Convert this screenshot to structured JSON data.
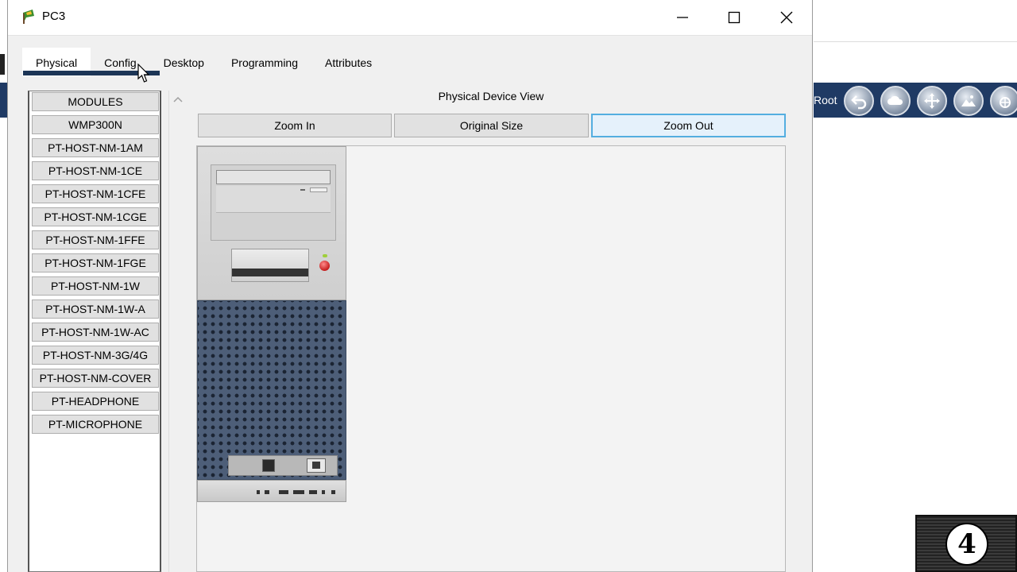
{
  "window": {
    "title": "PC3"
  },
  "tabs": [
    {
      "label": "Physical",
      "active": true
    },
    {
      "label": "Config",
      "active": false
    },
    {
      "label": "Desktop",
      "active": false
    },
    {
      "label": "Programming",
      "active": false
    },
    {
      "label": "Attributes",
      "active": false
    }
  ],
  "modules": [
    "MODULES",
    "WMP300N",
    "PT-HOST-NM-1AM",
    "PT-HOST-NM-1CE",
    "PT-HOST-NM-1CFE",
    "PT-HOST-NM-1CGE",
    "PT-HOST-NM-1FFE",
    "PT-HOST-NM-1FGE",
    "PT-HOST-NM-1W",
    "PT-HOST-NM-1W-A",
    "PT-HOST-NM-1W-AC",
    "PT-HOST-NM-3G/4G",
    "PT-HOST-NM-COVER",
    "PT-HEADPHONE",
    "PT-MICROPHONE"
  ],
  "device_view": {
    "title": "Physical Device View",
    "zoom_in": "Zoom In",
    "original_size": "Original Size",
    "zoom_out": "Zoom Out"
  },
  "background_app": {
    "root_label": "Root"
  },
  "watermark": {
    "text": "4"
  },
  "colors": {
    "accent": "#1c3556",
    "toolbar": "#1f3a64",
    "focus": "#54aee0"
  }
}
